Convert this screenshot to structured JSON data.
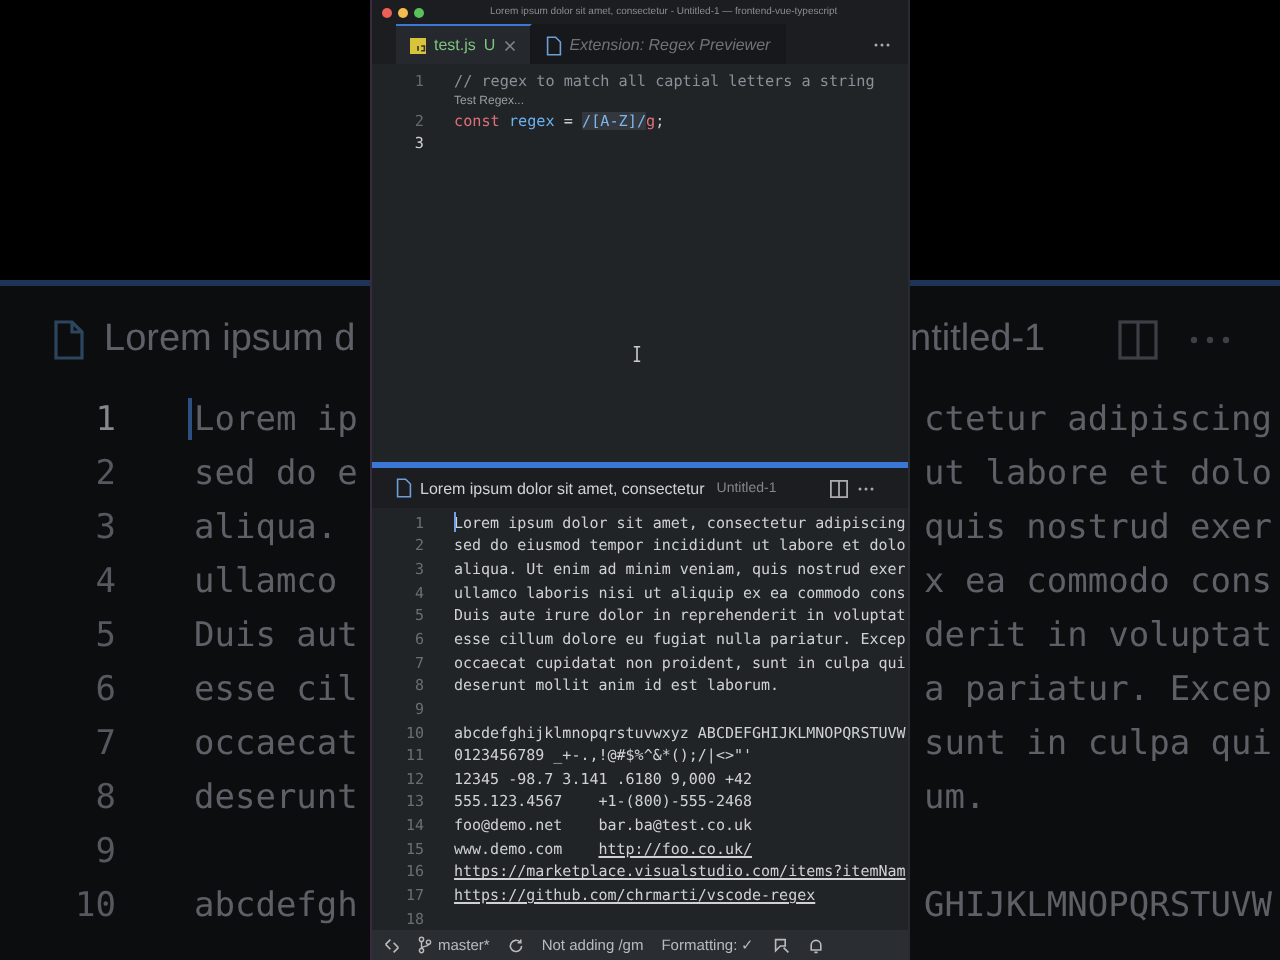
{
  "background_editor": {
    "title_left": "Lorem ipsum d",
    "title_right": "ntitled-1",
    "lines": [
      {
        "number": "1",
        "left": "Lorem ip",
        "right": "ctetur adipiscing",
        "cursor": true
      },
      {
        "number": "2",
        "left": "sed do e",
        "right": "ut labore et dolo"
      },
      {
        "number": "3",
        "left": "aliqua.",
        "right": "quis nostrud exer"
      },
      {
        "number": "4",
        "left": "ullamco",
        "right": "x ea commodo cons"
      },
      {
        "number": "5",
        "left": "Duis aut",
        "right": "derit in voluptat"
      },
      {
        "number": "6",
        "left": "esse cil",
        "right": "a pariatur. Excep"
      },
      {
        "number": "7",
        "left": "occaecat",
        "right": "sunt in culpa qui"
      },
      {
        "number": "8",
        "left": "deserunt",
        "right": "um."
      },
      {
        "number": "9"
      },
      {
        "number": "10",
        "left": "abcdefgh",
        "right": "GHIJKLMNOPQRSTUVW"
      }
    ]
  },
  "window": {
    "title": "Lorem ipsum dolor sit amet, consectetur - Untitled-1 — frontend-vue-typescript"
  },
  "tabs": [
    {
      "label": "test.js",
      "badge": "U",
      "selected": true,
      "preview": false,
      "kind": "js"
    },
    {
      "label": "Extension: Regex Previewer",
      "selected": false,
      "preview": true,
      "kind": "file"
    }
  ],
  "code_editor": {
    "lines": [
      {
        "kind": "line",
        "number": "1",
        "tokens": [
          {
            "kind": "comment",
            "text": "// regex to match all captial letters a string"
          }
        ]
      },
      {
        "kind": "codelens",
        "text": "Test Regex..."
      },
      {
        "kind": "line",
        "number": "2",
        "tokens": [
          {
            "kind": "keyword",
            "text": "const "
          },
          {
            "kind": "variable",
            "text": "regex"
          },
          {
            "kind": "plain",
            "text": " = "
          },
          {
            "kind": "regex",
            "text": "/[A-Z]/"
          },
          {
            "kind": "keyword",
            "text": "g"
          },
          {
            "kind": "plain",
            "text": ";"
          }
        ]
      },
      {
        "kind": "line",
        "number": "3",
        "current": true
      }
    ]
  },
  "preview_editor": {
    "title": "Lorem ipsum dolor sit amet, consectetur",
    "description": "Untitled-1",
    "lines": [
      {
        "number": "1",
        "text": "Lorem ipsum dolor sit amet, consectetur adipiscing",
        "cursor": true
      },
      {
        "number": "2",
        "text": "sed do eiusmod tempor incididunt ut labore et dolo"
      },
      {
        "number": "3",
        "text": "aliqua. Ut enim ad minim veniam, quis nostrud exer"
      },
      {
        "number": "4",
        "text": "ullamco laboris nisi ut aliquip ex ea commodo cons"
      },
      {
        "number": "5",
        "text": "Duis aute irure dolor in reprehenderit in voluptat"
      },
      {
        "number": "6",
        "text": "esse cillum dolore eu fugiat nulla pariatur. Excep"
      },
      {
        "number": "7",
        "text": "occaecat cupidatat non proident, sunt in culpa qui"
      },
      {
        "number": "8",
        "text": "deserunt mollit anim id est laborum."
      },
      {
        "number": "9"
      },
      {
        "number": "10",
        "text": "abcdefghijklmnopqrstuvwxyz ABCDEFGHIJKLMNOPQRSTUVW"
      },
      {
        "number": "11",
        "text": "0123456789 _+-.,!@#$%^&*();/|<>\"'"
      },
      {
        "number": "12",
        "text": "12345 -98.7 3.141 .6180 9,000 +42"
      },
      {
        "number": "13",
        "text": "555.123.4567    +1-(800)-555-2468"
      },
      {
        "number": "14",
        "text": "foo@demo.net    bar.ba@test.co.uk"
      },
      {
        "number": "15",
        "text": "www.demo.com    ",
        "link": "http://foo.co.uk/"
      },
      {
        "number": "16",
        "link": "https://marketplace.visualstudio.com/items?itemNam"
      },
      {
        "number": "17",
        "link": "https://github.com/chrmarti/vscode-regex"
      },
      {
        "number": "18"
      }
    ]
  },
  "status_bar": {
    "branch": "master*",
    "texts": [
      "Not adding /gm",
      "Formatting: ✓"
    ]
  }
}
